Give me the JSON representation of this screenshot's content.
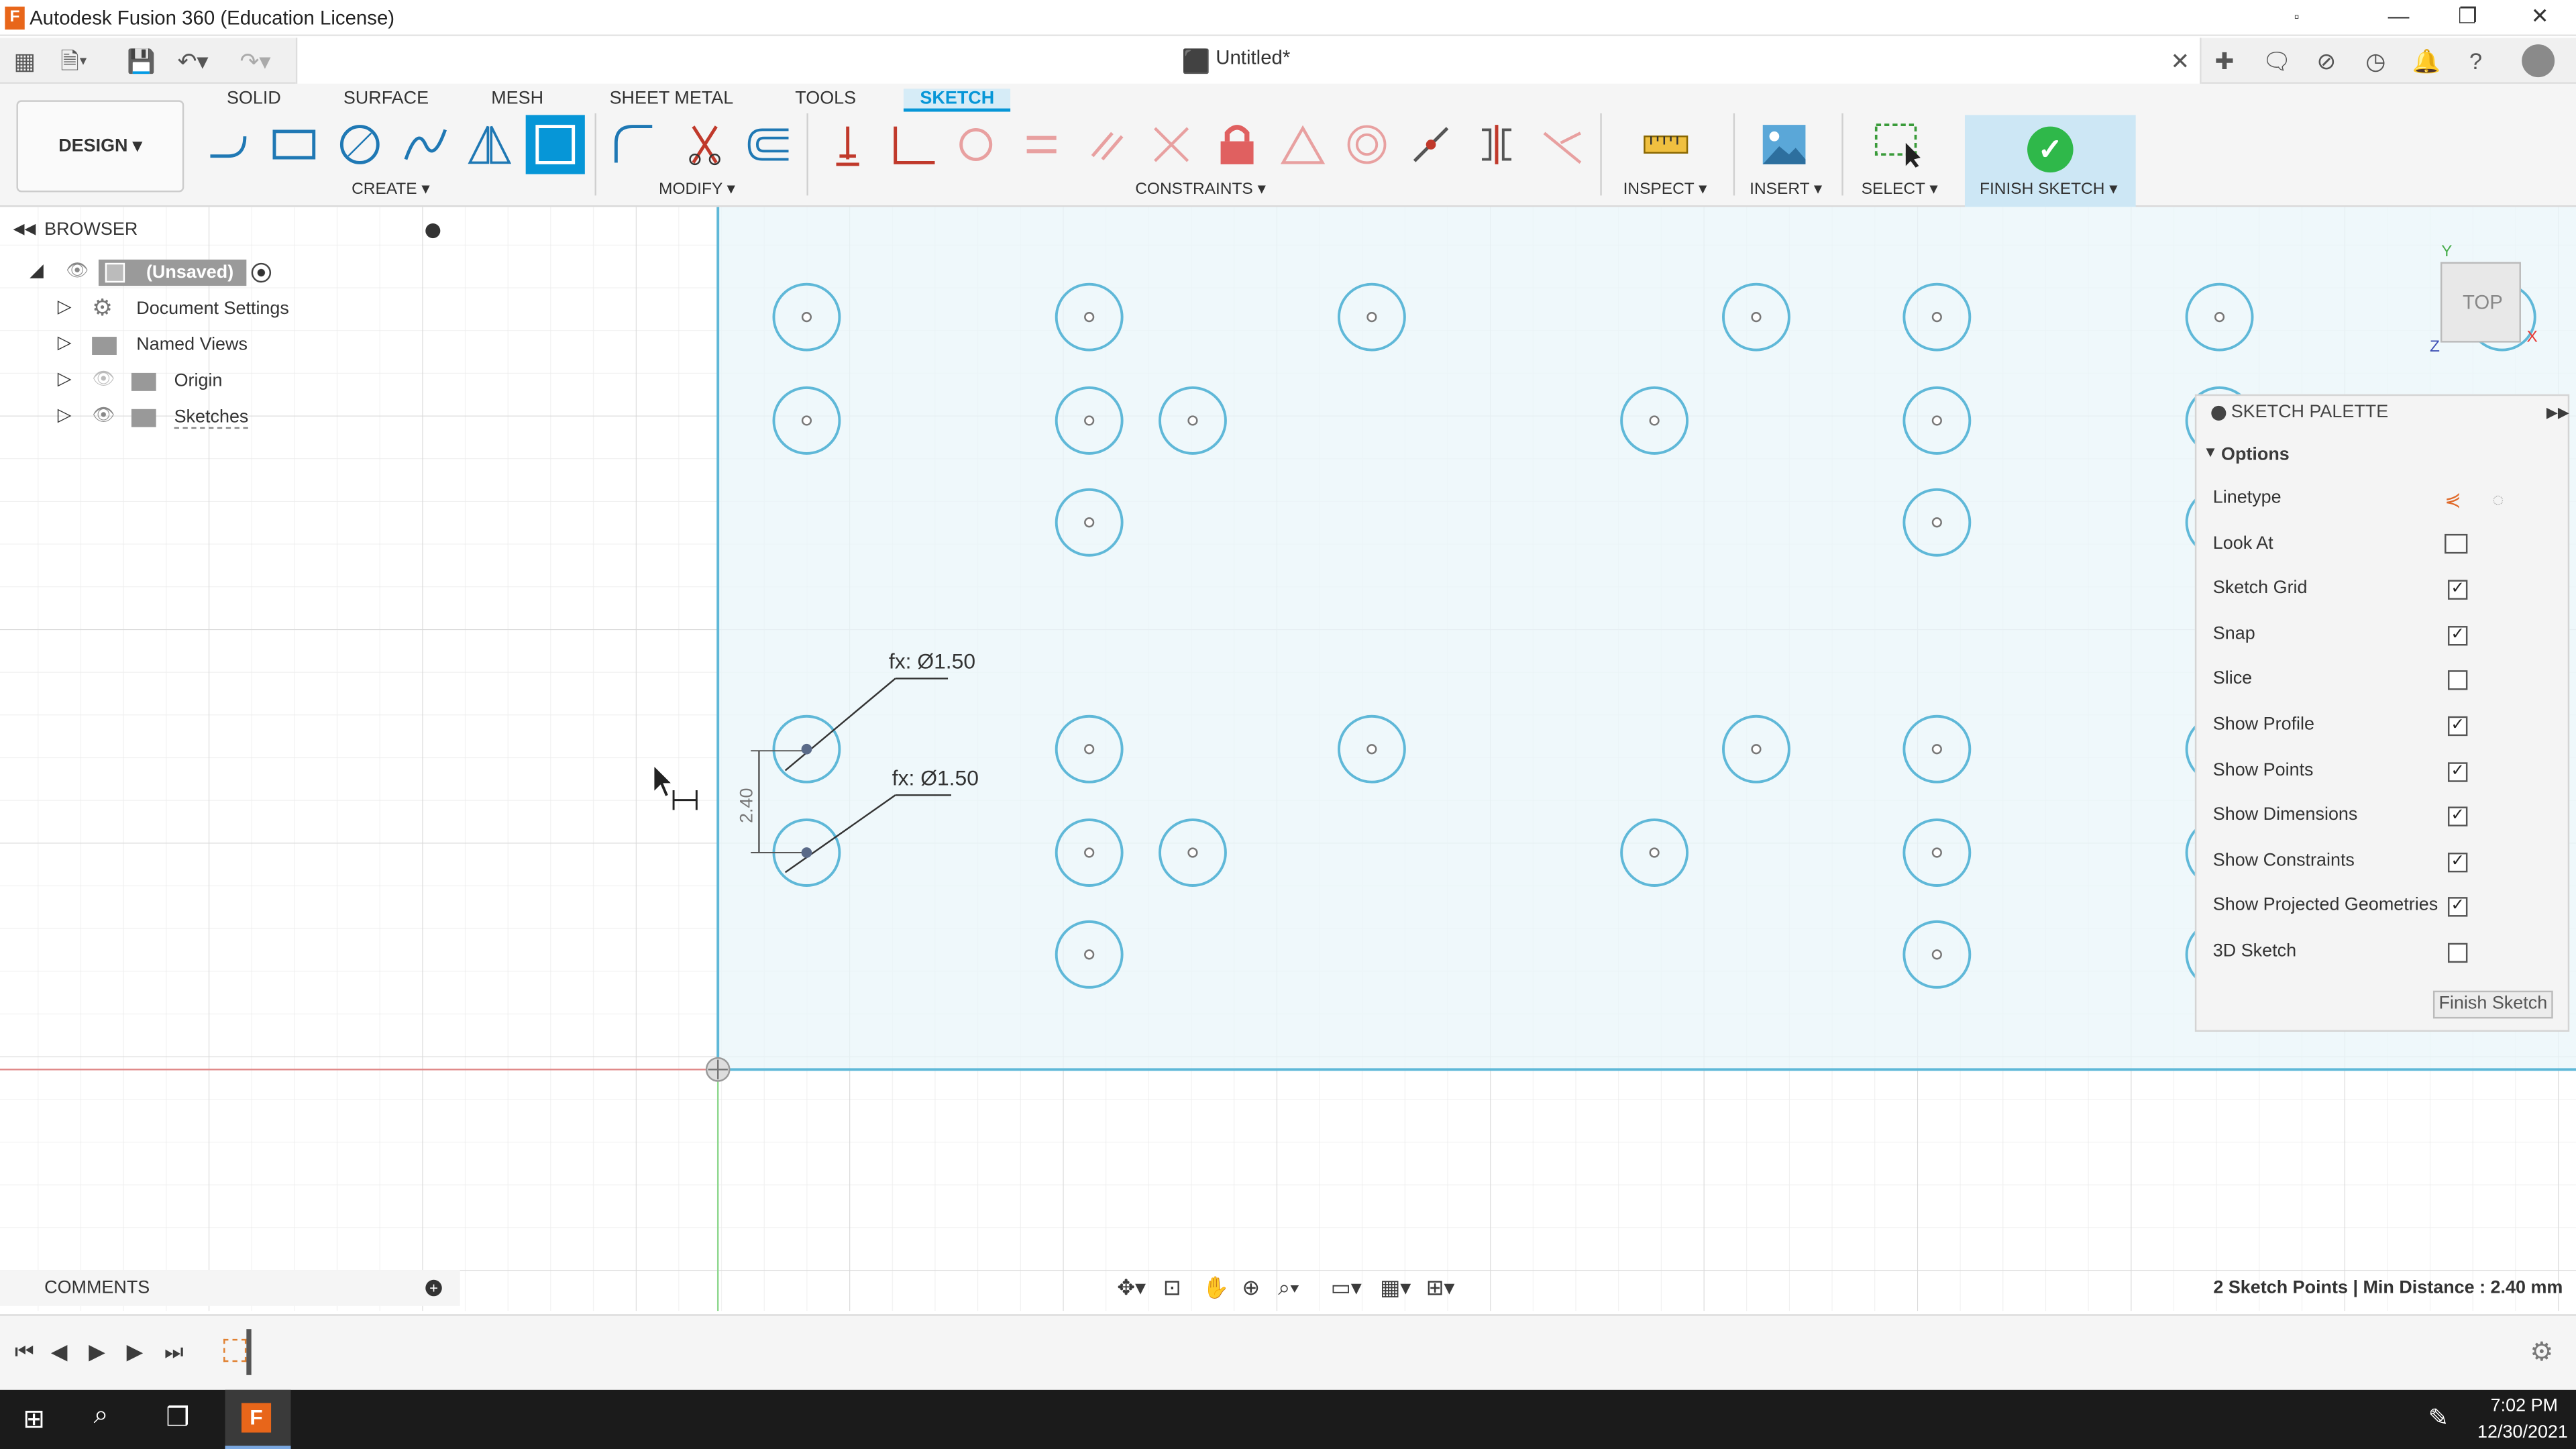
{
  "window": {
    "title": "Autodesk Fusion 360 (Education License)"
  },
  "doc_tab": {
    "title": "Untitled*"
  },
  "ribbon": {
    "tabs": [
      "SOLID",
      "SURFACE",
      "MESH",
      "SHEET METAL",
      "TOOLS",
      "SKETCH"
    ],
    "active_tab": "SKETCH",
    "design_label": "DESIGN ▾",
    "groups": {
      "create": "CREATE ▾",
      "modify": "MODIFY ▾",
      "constraints": "CONSTRAINTS ▾",
      "inspect": "INSPECT ▾",
      "insert": "INSERT ▾",
      "select": "SELECT ▾",
      "finish": "FINISH SKETCH ▾"
    }
  },
  "browser": {
    "header": "BROWSER",
    "root": "(Unsaved)",
    "items": [
      "Document Settings",
      "Named Views",
      "Origin",
      "Sketches"
    ]
  },
  "sketch": {
    "dim1": "fx: Ø1.50",
    "dim2": "fx: Ø1.50",
    "dim_vertical": "2.40",
    "viewcube": "TOP",
    "axis_y": "Y",
    "axis_z": "Z",
    "axis_x": "X"
  },
  "palette": {
    "title": "SKETCH PALETTE",
    "section": "Options",
    "rows": [
      {
        "label": "Linetype",
        "type": "icons"
      },
      {
        "label": "Look At",
        "type": "icon"
      },
      {
        "label": "Sketch Grid",
        "checked": "✓"
      },
      {
        "label": "Snap",
        "checked": "✓"
      },
      {
        "label": "Slice",
        "checked": ""
      },
      {
        "label": "Show Profile",
        "checked": "✓"
      },
      {
        "label": "Show Points",
        "checked": "✓"
      },
      {
        "label": "Show Dimensions",
        "checked": "✓"
      },
      {
        "label": "Show Constraints",
        "checked": "✓"
      },
      {
        "label": "Show Projected Geometries",
        "checked": "✓"
      },
      {
        "label": "3D Sketch",
        "checked": ""
      }
    ],
    "finish_button": "Finish Sketch"
  },
  "comments": {
    "label": "COMMENTS"
  },
  "status": {
    "text": "2 Sketch Points | Min Distance : 2.40 mm"
  },
  "taskbar": {
    "time": "7:02 PM",
    "date": "12/30/2021"
  },
  "colors": {
    "accent": "#0696d7",
    "sketch_line": "#5fb8d8",
    "sketch_fill": "#eaf5fa",
    "x_axis": "#e08a8a",
    "y_axis": "#8fd88f"
  }
}
